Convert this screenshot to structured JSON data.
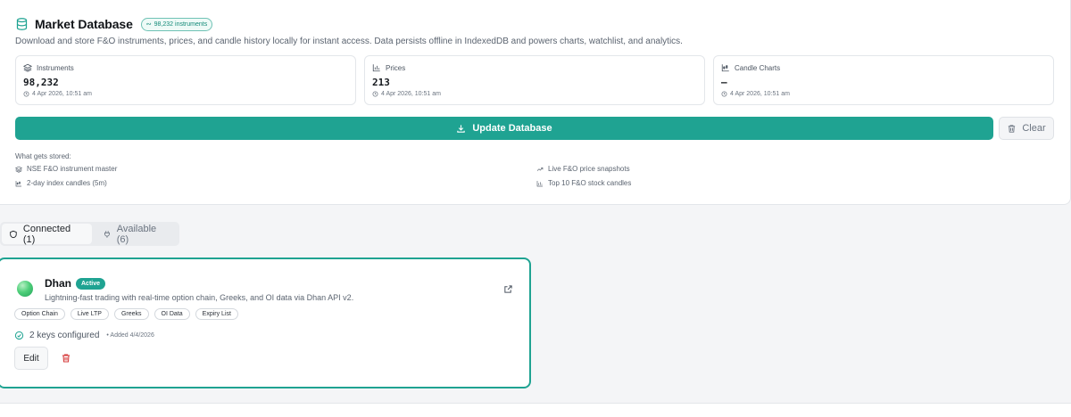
{
  "market_db": {
    "title": "Market Database",
    "badge_count": "98,232 instruments",
    "description": "Download and store F&O instruments, prices, and candle history locally for instant access. Data persists offline in IndexedDB and powers charts, watchlist, and analytics.",
    "stats": [
      {
        "label": "Instruments",
        "value": "98,232",
        "timestamp": "4 Apr 2026, 10:51 am",
        "icon": "layers-icon"
      },
      {
        "label": "Prices",
        "value": "213",
        "timestamp": "4 Apr 2026, 10:51 am",
        "icon": "bar-chart-icon"
      },
      {
        "label": "Candle Charts",
        "value": "—",
        "timestamp": "4 Apr 2026, 10:51 am",
        "icon": "candle-chart-icon"
      }
    ],
    "update_label": "Update Database",
    "clear_label": "Clear",
    "stored_title": "What gets stored:",
    "stored_items": [
      {
        "label": "NSE F&O instrument master",
        "icon": "layers-icon"
      },
      {
        "label": "Live F&O price snapshots",
        "icon": "trend-up-icon"
      },
      {
        "label": "2-day index candles (5m)",
        "icon": "candle-chart-icon"
      },
      {
        "label": "Top 10 F&O stock candles",
        "icon": "bar-chart-icon"
      }
    ]
  },
  "tabs": [
    {
      "label": "Connected (1)",
      "active": true,
      "icon": "shield-icon"
    },
    {
      "label": "Available (6)",
      "active": false,
      "icon": "plug-icon"
    }
  ],
  "broker": {
    "name": "Dhan",
    "status": "Active",
    "description": "Lightning-fast trading with real-time option chain, Greeks, and OI data via Dhan API v2.",
    "tags": [
      "Option Chain",
      "Live LTP",
      "Greeks",
      "OI Data",
      "Expiry List"
    ],
    "keys_label": "2 keys configured",
    "added_label": "• Added 4/4/2026",
    "edit_label": "Edit"
  },
  "colors": {
    "accent": "#1fa392",
    "danger": "#d63b3b"
  }
}
